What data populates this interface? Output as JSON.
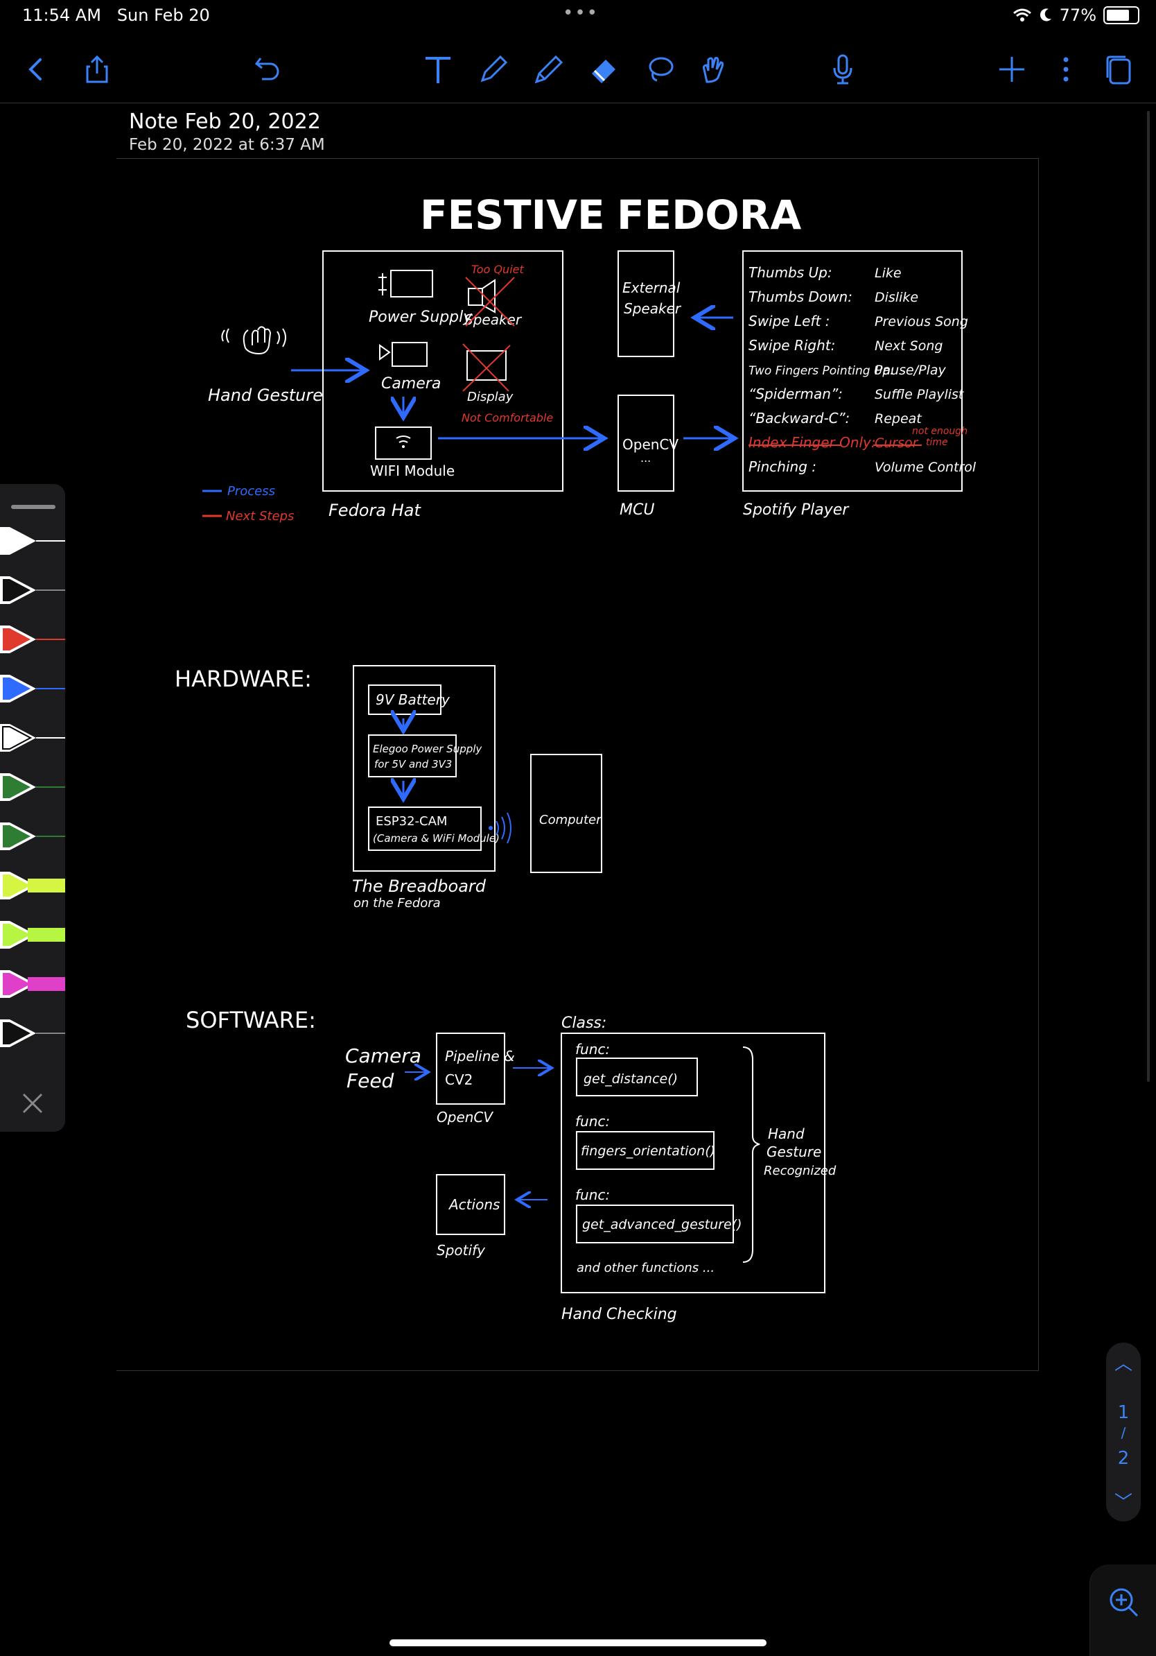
{
  "status_bar": {
    "time": "11:54 AM",
    "date": "Sun Feb 20",
    "dots": "•••",
    "battery": "77%",
    "battery_level": 0.77
  },
  "toolbar": {
    "icons": [
      "back-icon",
      "share-icon",
      "undo-icon",
      "text-tool-icon",
      "pencil-icon",
      "marker-icon",
      "eraser-icon",
      "lasso-icon",
      "gesture-icon",
      "microphone-icon",
      "add-icon",
      "more-icon",
      "pages-icon"
    ],
    "accent": "#3b82f6"
  },
  "note": {
    "title": "Note Feb 20, 2022",
    "date": "Feb 20, 2022 at 6:37 AM"
  },
  "sketch": {
    "title_left": "FESTIVE",
    "title_right": "FEDORA",
    "hand_gesture": "Hand Gesture",
    "fedora_hat": "Fedora Hat",
    "power_supply": "Power Supply",
    "camera": "Camera",
    "wifi_module": "WIFI Module",
    "too_quiet": "Too Quiet",
    "speaker": "Speaker",
    "display": "Display",
    "not_comfortable": "Not Comfortable",
    "external_speaker_1": "External",
    "external_speaker_2": "Speaker",
    "opencv": "OpenCV",
    "ellipsis": "...",
    "mcu": "MCU",
    "spotify_player": "Spotify Player",
    "legend_process": "Process",
    "legend_next": "Next Steps",
    "gestures": [
      {
        "g": "Thumbs Up:",
        "a": "Like"
      },
      {
        "g": "Thumbs Down:",
        "a": "Dislike"
      },
      {
        "g": "Swipe Left :",
        "a": "Previous Song"
      },
      {
        "g": "Swipe Right:",
        "a": "Next Song"
      },
      {
        "g": "Two Fingers Pointing Up:",
        "a": "Pause/Play"
      },
      {
        "g": "“Spiderman”:",
        "a": "Suffle Playlist"
      },
      {
        "g": "“Backward-C”:",
        "a": "Repeat"
      },
      {
        "g": "Index Finger Only:",
        "a": "Cursor"
      },
      {
        "g": "Pinching :",
        "a": "Volume Control"
      }
    ],
    "not_enough_1": "not enough",
    "not_enough_2": "time",
    "hardware": "HARDWARE:",
    "battery_9v": "9V Battery",
    "elegoo_1": "Elegoo Power Supply",
    "elegoo_2": "for 5V and 3V3",
    "esp_1": "ESP32-CAM",
    "esp_2": "(Camera & WiFi Module)",
    "computer": "Computer",
    "breadboard_1": "The Breadboard",
    "breadboard_2": "on the Fedora",
    "software": "SOFTWARE:",
    "camera_feed_1": "Camera",
    "camera_feed_2": "Feed",
    "pipeline_1": "Pipeline &",
    "pipeline_2": "CV2",
    "opencv_lbl": "OpenCV",
    "actions": "Actions",
    "spotify": "Spotify",
    "class": "Class:",
    "func": "func:",
    "f1": "get_distance()",
    "f2": "fingers_orientation()",
    "f3": "get_advanced_gesture()",
    "other": "and other functions ...",
    "hand_checking": "Hand Checking",
    "hgr_1": "Hand",
    "hgr_2": "Gesture",
    "hgr_3": "Recognized",
    "colors": {
      "blue": "#2f6bff",
      "red": "#e0392e",
      "white": "#ffffff"
    }
  },
  "palette": {
    "pens": [
      "#ffffff",
      "#111111",
      "#e0392e",
      "#2f6bff",
      "#ffffff",
      "#2e7d32",
      "#2e7d32",
      "#d4f542",
      "#b6f542",
      "#e040c8",
      "#111111"
    ],
    "close_icon": "close-icon"
  },
  "page_nav": {
    "current": "1",
    "separator": "/",
    "total": "2"
  }
}
